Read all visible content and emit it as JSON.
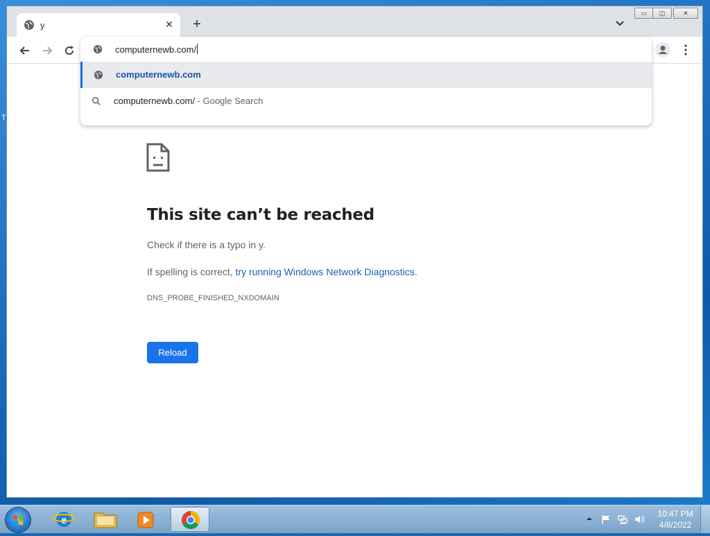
{
  "desktop": {
    "left_text": "T"
  },
  "tab": {
    "title": "y",
    "close_glyph": "✕"
  },
  "new_tab_glyph": "+",
  "omnibox": {
    "input_value": "computernewb.com/",
    "suggestions": [
      {
        "text": "computernewb.com",
        "suffix": "",
        "icon": "globe-icon",
        "selected": true
      },
      {
        "text": "computernewb.com/",
        "suffix": " - Google Search",
        "icon": "search-icon",
        "selected": false
      }
    ]
  },
  "error_page": {
    "title": "This site can’t be reached",
    "line1": "Check if there is a typo in y.",
    "line2_prefix": "If spelling is correct, ",
    "line2_link": "try running Windows Network Diagnostics",
    "line2_suffix": ".",
    "error_code": "DNS_PROBE_FINISHED_NXDOMAIN",
    "reload_label": "Reload"
  },
  "window_controls": {
    "minimize": "▭",
    "maximize": "◫",
    "close": "✕"
  },
  "taskbar": {
    "clock_time": "10:47 PM",
    "clock_date": "4/8/2022"
  },
  "colors": {
    "accent": "#1a73e8",
    "link": "#1a5fb4"
  }
}
